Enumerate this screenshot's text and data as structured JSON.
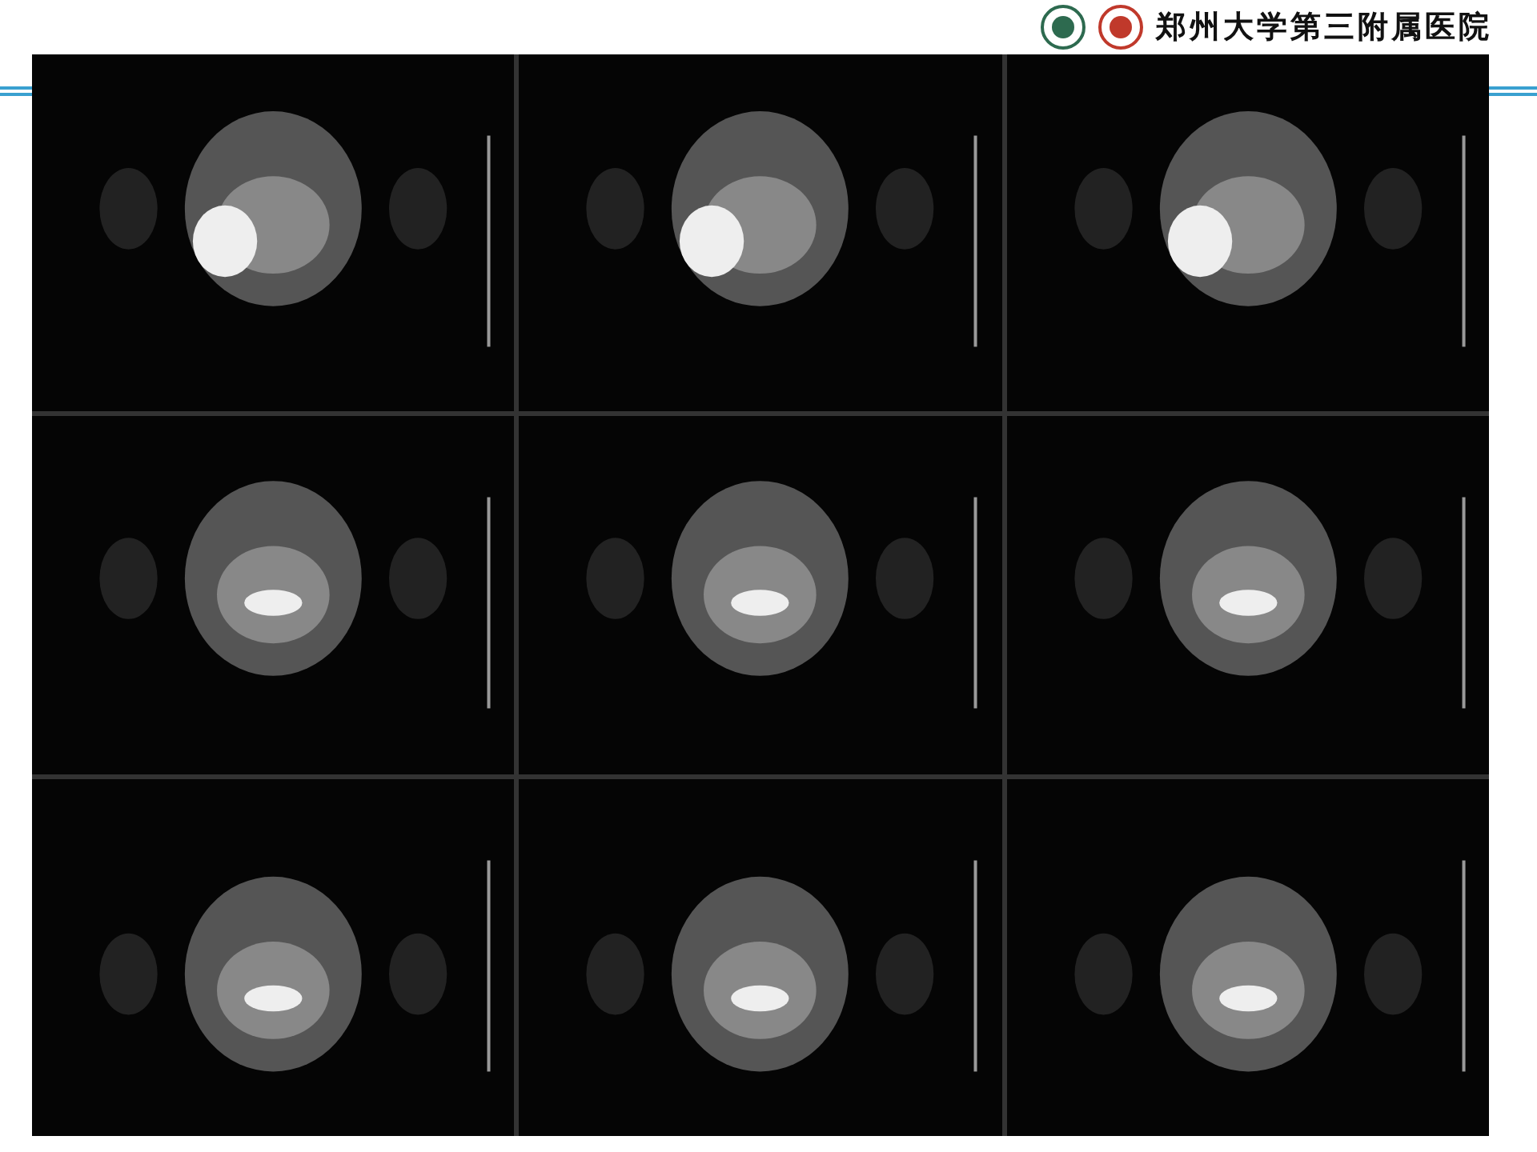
{
  "header": {
    "title": "郑州大学第三附属医院"
  },
  "panels": [
    {
      "kind": "mri-scan"
    },
    {
      "kind": "mri-scan"
    },
    {
      "kind": "mri-scan"
    },
    {
      "kind": "mri-scan"
    },
    {
      "kind": "mri-scan"
    },
    {
      "kind": "mri-scan"
    },
    {
      "kind": "mri-scan"
    },
    {
      "kind": "mri-scan"
    },
    {
      "kind": "mri-scan"
    }
  ]
}
